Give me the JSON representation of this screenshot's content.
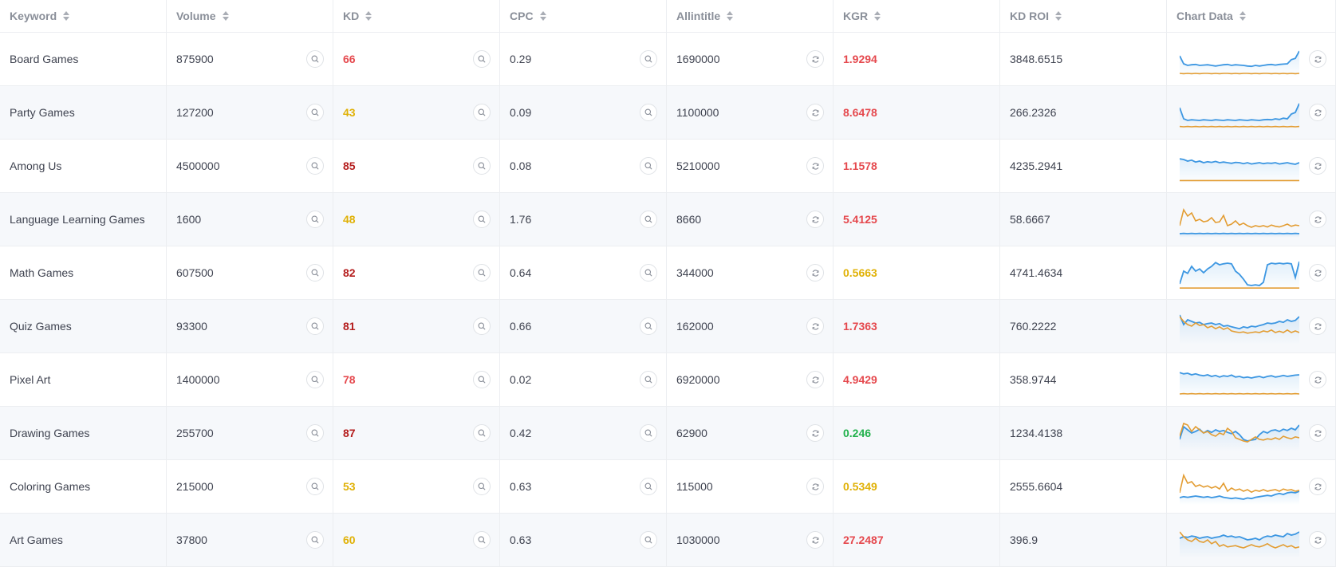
{
  "headers": [
    "Keyword",
    "Volume",
    "KD",
    "CPC",
    "Allintitle",
    "KGR",
    "KD ROI",
    "Chart Data"
  ],
  "colors": {
    "red": "#e5484d",
    "darkred": "#b41c1c",
    "yellow": "#e0b106",
    "green": "#22b14c",
    "blue": "#3d97e2",
    "orange": "#e39d33"
  },
  "icons": {
    "search": "search-icon",
    "refresh": "refresh-icon"
  },
  "rows": [
    {
      "keyword": "Board Games",
      "volume": "875900",
      "kd": "66",
      "kd_color": "red",
      "cpc": "0.29",
      "allintitle": "1690000",
      "kgr": "1.9294",
      "kgr_color": "red",
      "kdroi": "3848.6515",
      "blue": [
        0.6,
        0.35,
        0.3,
        0.32,
        0.33,
        0.3,
        0.31,
        0.32,
        0.3,
        0.28,
        0.3,
        0.32,
        0.33,
        0.3,
        0.32,
        0.31,
        0.3,
        0.28,
        0.27,
        0.3,
        0.28,
        0.3,
        0.32,
        0.33,
        0.31,
        0.33,
        0.34,
        0.35,
        0.48,
        0.52,
        0.75
      ],
      "orange": [
        0.05,
        0.04,
        0.05,
        0.04,
        0.05,
        0.04,
        0.05,
        0.05,
        0.04,
        0.05,
        0.04,
        0.05,
        0.05,
        0.04,
        0.05,
        0.04,
        0.05,
        0.05,
        0.04,
        0.05,
        0.04,
        0.05,
        0.05,
        0.04,
        0.05,
        0.04,
        0.05,
        0.04,
        0.05,
        0.04,
        0.05
      ]
    },
    {
      "keyword": "Party Games",
      "volume": "127200",
      "kd": "43",
      "kd_color": "yellow",
      "cpc": "0.09",
      "allintitle": "1100000",
      "kgr": "8.6478",
      "kgr_color": "red",
      "kdroi": "266.2326",
      "blue": [
        0.65,
        0.3,
        0.25,
        0.27,
        0.26,
        0.25,
        0.27,
        0.26,
        0.25,
        0.27,
        0.26,
        0.25,
        0.27,
        0.26,
        0.25,
        0.27,
        0.26,
        0.25,
        0.27,
        0.26,
        0.25,
        0.27,
        0.28,
        0.27,
        0.3,
        0.28,
        0.32,
        0.3,
        0.45,
        0.5,
        0.78
      ],
      "orange": [
        0.06,
        0.05,
        0.06,
        0.05,
        0.06,
        0.05,
        0.06,
        0.05,
        0.06,
        0.05,
        0.06,
        0.05,
        0.06,
        0.05,
        0.06,
        0.05,
        0.06,
        0.05,
        0.06,
        0.05,
        0.06,
        0.05,
        0.06,
        0.05,
        0.06,
        0.05,
        0.06,
        0.05,
        0.06,
        0.05,
        0.06
      ]
    },
    {
      "keyword": "Among Us",
      "volume": "4500000",
      "kd": "85",
      "kd_color": "darkred",
      "cpc": "0.08",
      "allintitle": "5210000",
      "kgr": "1.1578",
      "kgr_color": "red",
      "kdroi": "4235.2941",
      "blue": [
        0.72,
        0.7,
        0.65,
        0.68,
        0.62,
        0.65,
        0.6,
        0.63,
        0.61,
        0.64,
        0.6,
        0.62,
        0.6,
        0.58,
        0.61,
        0.6,
        0.57,
        0.6,
        0.56,
        0.58,
        0.6,
        0.57,
        0.59,
        0.58,
        0.6,
        0.56,
        0.58,
        0.6,
        0.57,
        0.55,
        0.6
      ],
      "orange": [
        0.04,
        0.04,
        0.04,
        0.04,
        0.04,
        0.04,
        0.04,
        0.04,
        0.04,
        0.04,
        0.04,
        0.04,
        0.04,
        0.04,
        0.04,
        0.04,
        0.04,
        0.04,
        0.04,
        0.04,
        0.04,
        0.04,
        0.04,
        0.04,
        0.04,
        0.04,
        0.04,
        0.04,
        0.04,
        0.04,
        0.04
      ]
    },
    {
      "keyword": "Language Learning Games",
      "volume": "1600",
      "kd": "48",
      "kd_color": "yellow",
      "cpc": "1.76",
      "allintitle": "8660",
      "kgr": "5.4125",
      "kgr_color": "red",
      "kdroi": "58.6667",
      "orange": [
        0.3,
        0.8,
        0.6,
        0.7,
        0.45,
        0.5,
        0.42,
        0.45,
        0.55,
        0.4,
        0.42,
        0.62,
        0.3,
        0.35,
        0.45,
        0.32,
        0.38,
        0.3,
        0.25,
        0.3,
        0.27,
        0.3,
        0.26,
        0.32,
        0.28,
        0.26,
        0.3,
        0.35,
        0.28,
        0.32,
        0.3
      ],
      "blue": [
        0.05,
        0.06,
        0.05,
        0.06,
        0.05,
        0.06,
        0.05,
        0.06,
        0.05,
        0.06,
        0.05,
        0.06,
        0.05,
        0.06,
        0.05,
        0.06,
        0.05,
        0.06,
        0.05,
        0.06,
        0.05,
        0.06,
        0.05,
        0.06,
        0.05,
        0.06,
        0.05,
        0.06,
        0.05,
        0.06,
        0.05
      ]
    },
    {
      "keyword": "Math Games",
      "volume": "607500",
      "kd": "82",
      "kd_color": "darkred",
      "cpc": "0.64",
      "allintitle": "344000",
      "kgr": "0.5663",
      "kgr_color": "yellow",
      "kdroi": "4741.4634",
      "blue": [
        0.15,
        0.55,
        0.48,
        0.7,
        0.55,
        0.62,
        0.5,
        0.62,
        0.7,
        0.82,
        0.75,
        0.78,
        0.8,
        0.78,
        0.55,
        0.45,
        0.3,
        0.12,
        0.1,
        0.12,
        0.1,
        0.2,
        0.75,
        0.8,
        0.78,
        0.8,
        0.78,
        0.8,
        0.78,
        0.35,
        0.85
      ],
      "orange": [
        0.02,
        0.02,
        0.02,
        0.02,
        0.02,
        0.02,
        0.02,
        0.02,
        0.02,
        0.02,
        0.02,
        0.02,
        0.02,
        0.02,
        0.02,
        0.02,
        0.02,
        0.02,
        0.02,
        0.02,
        0.02,
        0.02,
        0.02,
        0.02,
        0.02,
        0.02,
        0.02,
        0.02,
        0.02,
        0.02,
        0.02
      ]
    },
    {
      "keyword": "Quiz Games",
      "volume": "93300",
      "kd": "81",
      "kd_color": "darkred",
      "cpc": "0.66",
      "allintitle": "162000",
      "kgr": "1.7363",
      "kgr_color": "red",
      "kdroi": "760.2222",
      "blue": [
        0.85,
        0.55,
        0.7,
        0.65,
        0.6,
        0.62,
        0.55,
        0.58,
        0.6,
        0.55,
        0.58,
        0.5,
        0.52,
        0.48,
        0.45,
        0.42,
        0.48,
        0.45,
        0.5,
        0.48,
        0.52,
        0.55,
        0.6,
        0.58,
        0.6,
        0.65,
        0.62,
        0.7,
        0.65,
        0.68,
        0.8
      ],
      "orange": [
        0.8,
        0.65,
        0.55,
        0.5,
        0.6,
        0.52,
        0.55,
        0.45,
        0.5,
        0.42,
        0.48,
        0.4,
        0.45,
        0.35,
        0.32,
        0.3,
        0.32,
        0.28,
        0.3,
        0.32,
        0.3,
        0.35,
        0.32,
        0.38,
        0.3,
        0.34,
        0.3,
        0.38,
        0.3,
        0.35,
        0.3
      ]
    },
    {
      "keyword": "Pixel Art",
      "volume": "1400000",
      "kd": "78",
      "kd_color": "red",
      "cpc": "0.02",
      "allintitle": "6920000",
      "kgr": "4.9429",
      "kgr_color": "red",
      "kdroi": "358.9744",
      "blue": [
        0.72,
        0.68,
        0.7,
        0.65,
        0.68,
        0.64,
        0.62,
        0.65,
        0.6,
        0.63,
        0.58,
        0.62,
        0.6,
        0.64,
        0.58,
        0.6,
        0.56,
        0.58,
        0.55,
        0.58,
        0.6,
        0.56,
        0.6,
        0.62,
        0.58,
        0.6,
        0.63,
        0.6,
        0.62,
        0.64,
        0.65
      ],
      "orange": [
        0.05,
        0.06,
        0.05,
        0.06,
        0.05,
        0.06,
        0.05,
        0.06,
        0.05,
        0.06,
        0.05,
        0.06,
        0.05,
        0.06,
        0.05,
        0.06,
        0.05,
        0.06,
        0.05,
        0.06,
        0.05,
        0.06,
        0.05,
        0.06,
        0.05,
        0.06,
        0.05,
        0.06,
        0.05,
        0.06,
        0.05
      ]
    },
    {
      "keyword": "Drawing Games",
      "volume": "255700",
      "kd": "87",
      "kd_color": "darkred",
      "cpc": "0.42",
      "allintitle": "62900",
      "kgr": "0.246",
      "kgr_color": "green",
      "kdroi": "1234.4138",
      "blue": [
        0.3,
        0.7,
        0.6,
        0.5,
        0.55,
        0.62,
        0.5,
        0.58,
        0.52,
        0.6,
        0.55,
        0.58,
        0.52,
        0.48,
        0.55,
        0.45,
        0.3,
        0.25,
        0.28,
        0.3,
        0.45,
        0.55,
        0.5,
        0.58,
        0.6,
        0.55,
        0.62,
        0.58,
        0.65,
        0.6,
        0.75
      ],
      "orange": [
        0.4,
        0.8,
        0.75,
        0.55,
        0.7,
        0.6,
        0.5,
        0.55,
        0.45,
        0.4,
        0.5,
        0.45,
        0.65,
        0.55,
        0.35,
        0.3,
        0.25,
        0.22,
        0.3,
        0.38,
        0.3,
        0.28,
        0.32,
        0.3,
        0.35,
        0.3,
        0.4,
        0.35,
        0.32,
        0.38,
        0.35
      ]
    },
    {
      "keyword": "Coloring Games",
      "volume": "215000",
      "kd": "53",
      "kd_color": "yellow",
      "cpc": "0.63",
      "allintitle": "115000",
      "kgr": "0.5349",
      "kgr_color": "yellow",
      "kdroi": "2555.6604",
      "orange": [
        0.3,
        0.85,
        0.6,
        0.65,
        0.5,
        0.55,
        0.48,
        0.52,
        0.45,
        0.5,
        0.42,
        0.6,
        0.35,
        0.45,
        0.38,
        0.42,
        0.35,
        0.4,
        0.32,
        0.38,
        0.35,
        0.4,
        0.35,
        0.38,
        0.4,
        0.35,
        0.42,
        0.38,
        0.4,
        0.35,
        0.38
      ],
      "blue": [
        0.15,
        0.18,
        0.16,
        0.18,
        0.2,
        0.18,
        0.16,
        0.18,
        0.15,
        0.17,
        0.2,
        0.16,
        0.14,
        0.12,
        0.14,
        0.12,
        0.1,
        0.14,
        0.12,
        0.16,
        0.18,
        0.2,
        0.22,
        0.2,
        0.25,
        0.28,
        0.25,
        0.3,
        0.32,
        0.3,
        0.35
      ]
    },
    {
      "keyword": "Art Games",
      "volume": "37800",
      "kd": "60",
      "kd_color": "yellow",
      "cpc": "0.63",
      "allintitle": "1030000",
      "kgr": "27.2487",
      "kgr_color": "red",
      "kdroi": "396.9",
      "blue": [
        0.55,
        0.6,
        0.58,
        0.62,
        0.6,
        0.55,
        0.58,
        0.6,
        0.55,
        0.58,
        0.6,
        0.65,
        0.6,
        0.62,
        0.58,
        0.6,
        0.55,
        0.5,
        0.52,
        0.55,
        0.5,
        0.58,
        0.62,
        0.6,
        0.65,
        0.62,
        0.6,
        0.7,
        0.65,
        0.68,
        0.75
      ],
      "orange": [
        0.75,
        0.6,
        0.5,
        0.45,
        0.55,
        0.45,
        0.42,
        0.5,
        0.38,
        0.45,
        0.3,
        0.35,
        0.28,
        0.3,
        0.32,
        0.28,
        0.25,
        0.3,
        0.35,
        0.3,
        0.28,
        0.32,
        0.38,
        0.3,
        0.25,
        0.3,
        0.35,
        0.28,
        0.32,
        0.25,
        0.28
      ]
    }
  ]
}
